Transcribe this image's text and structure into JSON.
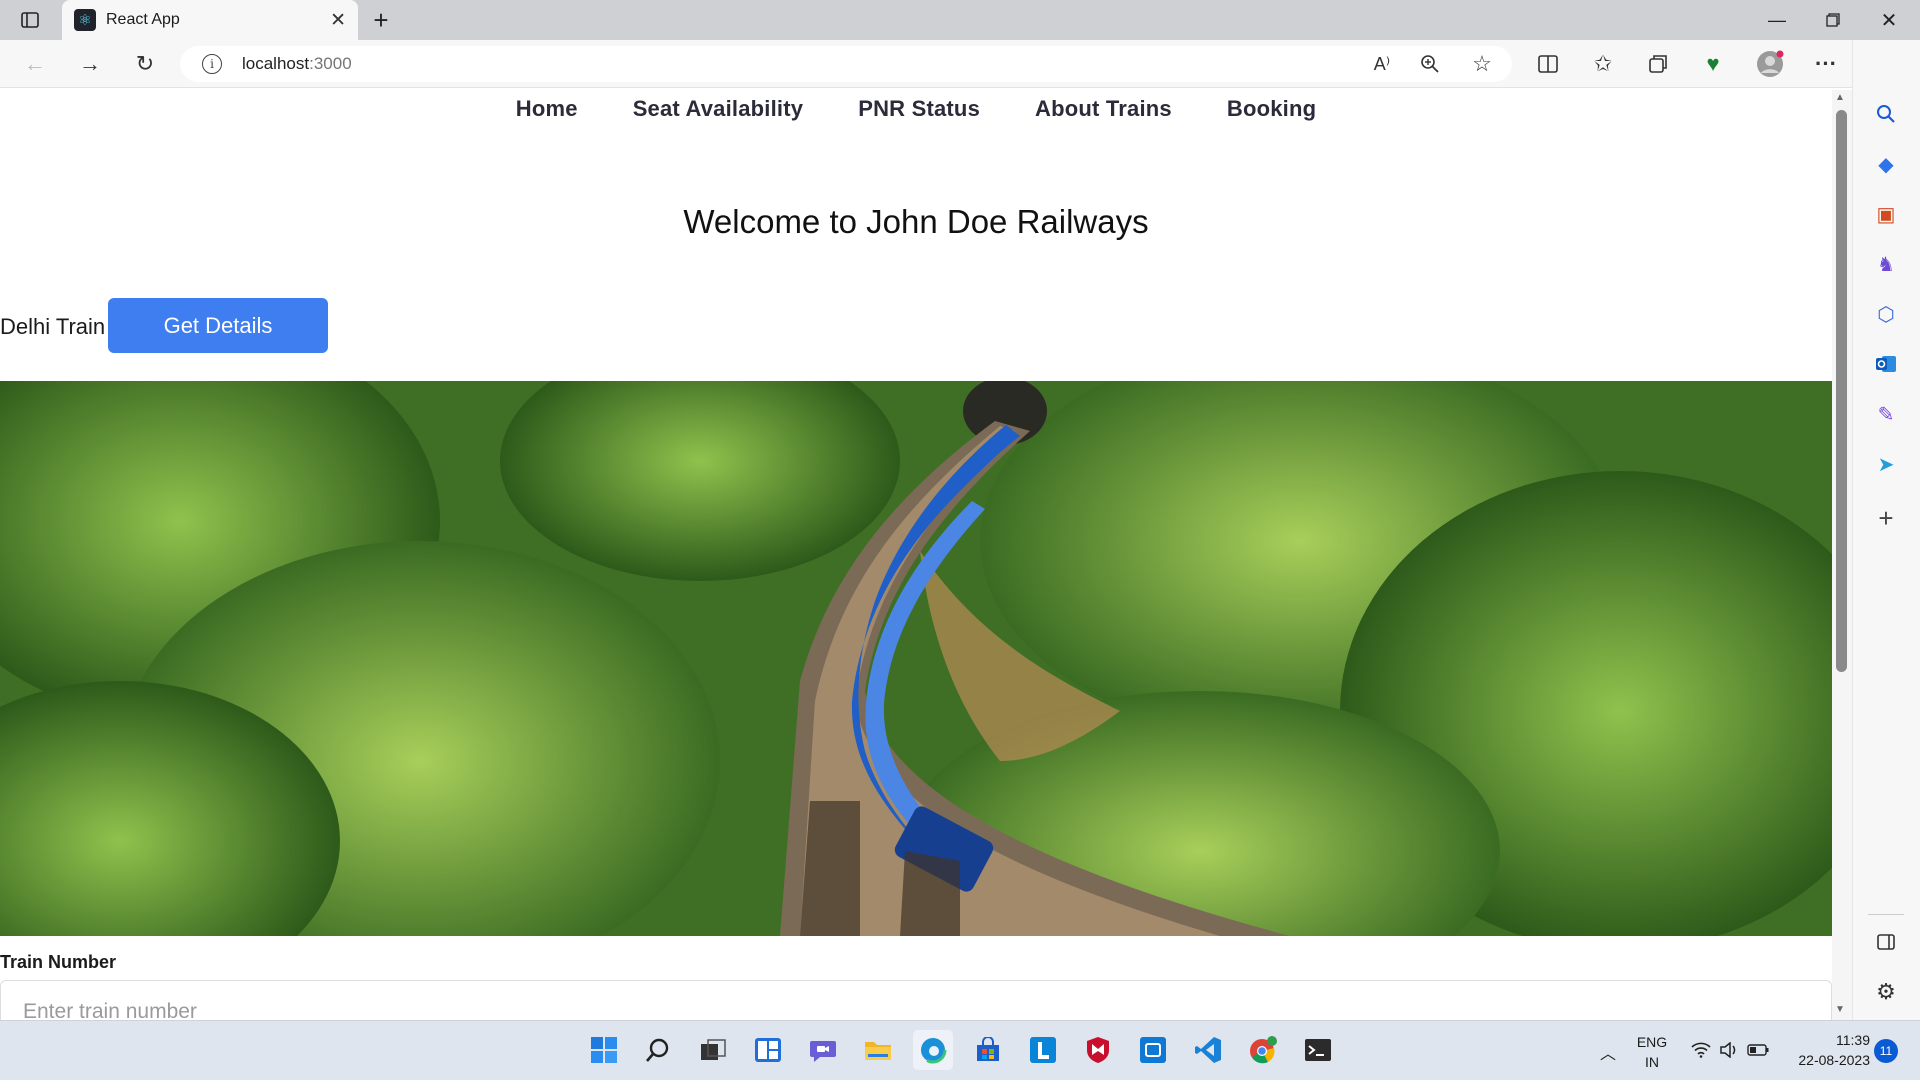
{
  "browser": {
    "tab_title": "React App",
    "url_host": "localhost",
    "url_port": ":3000",
    "icons": [
      "tab-actions-icon",
      "react-favicon",
      "close-icon",
      "new-tab-icon",
      "back-icon",
      "forward-icon",
      "refresh-icon",
      "info-icon",
      "read-aloud-icon",
      "zoom-icon",
      "favorite-star-icon",
      "split-screen-icon",
      "favorites-icon",
      "collections-icon",
      "browser-essentials-icon",
      "profile-avatar",
      "more-icon",
      "bing-copilot-icon",
      "minimize-icon",
      "maximize-icon",
      "window-close-icon"
    ],
    "read_aloud_glyph": "A⁾",
    "more_glyph": "···"
  },
  "sidebar": {
    "icons": [
      "search-icon",
      "shopping-tag-icon",
      "tools-icon",
      "games-icon",
      "microsoft-365-icon",
      "outlook-icon",
      "designer-icon",
      "telegram-icon",
      "add-icon",
      "sidebar-toggle-icon",
      "settings-icon"
    ]
  },
  "nav": {
    "items": [
      {
        "label": "Home"
      },
      {
        "label": "Seat Availability"
      },
      {
        "label": "PNR Status"
      },
      {
        "label": "About Trains"
      },
      {
        "label": "Booking"
      }
    ]
  },
  "main": {
    "welcome": "Welcome to John Doe Railways",
    "delhi_label": "Delhi Train",
    "get_details": "Get Details",
    "train_number_label": "Train Number",
    "train_number_placeholder": "Enter train number"
  },
  "taskbar": {
    "icons": [
      "windows-start-icon",
      "search-icon",
      "task-view-icon",
      "widgets-icon",
      "teams-chat-icon",
      "file-explorer-icon",
      "edge-icon",
      "store-icon",
      "l-app-icon",
      "mcafee-icon",
      "outlook-icon",
      "vscode-icon",
      "chrome-icon",
      "terminal-icon"
    ],
    "lang_line1": "ENG",
    "lang_line2": "IN",
    "time": "11:39",
    "date": "22-08-2023",
    "notifications": "11"
  }
}
